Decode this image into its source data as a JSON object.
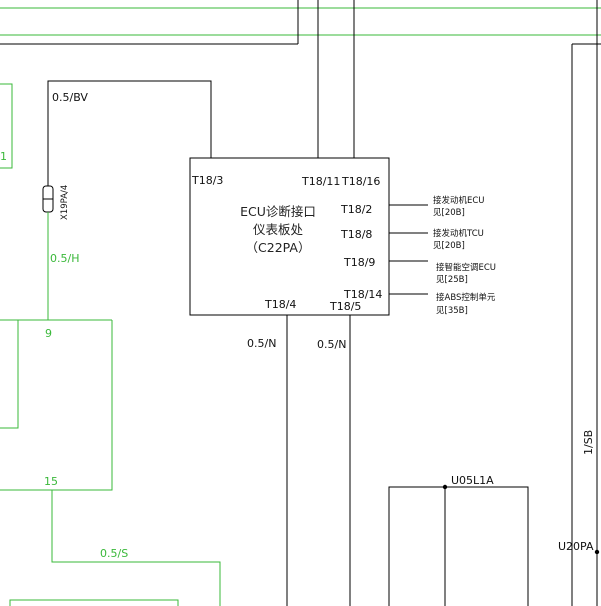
{
  "colors": {
    "wire": "#000000",
    "green_wire": "#3ab83a"
  },
  "ecu_box": {
    "title_line1": "ECU诊断接口",
    "title_line2": "仪表板处",
    "title_line3": "（C22PA）"
  },
  "pins": {
    "t18_3": "T18/3",
    "t18_11": "T18/11",
    "t18_16": "T18/16",
    "t18_2": "T18/2",
    "t18_8": "T18/8",
    "t18_9": "T18/9",
    "t18_14": "T18/14",
    "t18_4": "T18/4",
    "t18_5": "T18/5"
  },
  "wires": {
    "w_05bv": "0.5/BV",
    "w_05h": "0.5/H",
    "w_05n_left": "0.5/N",
    "w_05n_right": "0.5/N",
    "w_05s": "0.5/S",
    "w_1sb": "1/SB"
  },
  "connector": {
    "x19pa4": "X19PA/4"
  },
  "notes": {
    "engine_ecu": "接发动机ECU",
    "engine_ecu_ref": "见[20B]",
    "tcu": "接发动机TCU",
    "tcu_ref": "见[20B]",
    "ac_ecu": "接智能空调ECU",
    "ac_ecu_ref": "见[25B]",
    "abs": "接ABS控制单元",
    "abs_ref": "见[35B]"
  },
  "left_labels": {
    "n1": "1",
    "n9": "9",
    "n15": "15"
  },
  "grounds": {
    "u05l1a": "U05L1A",
    "u20pa": "U20PA"
  }
}
